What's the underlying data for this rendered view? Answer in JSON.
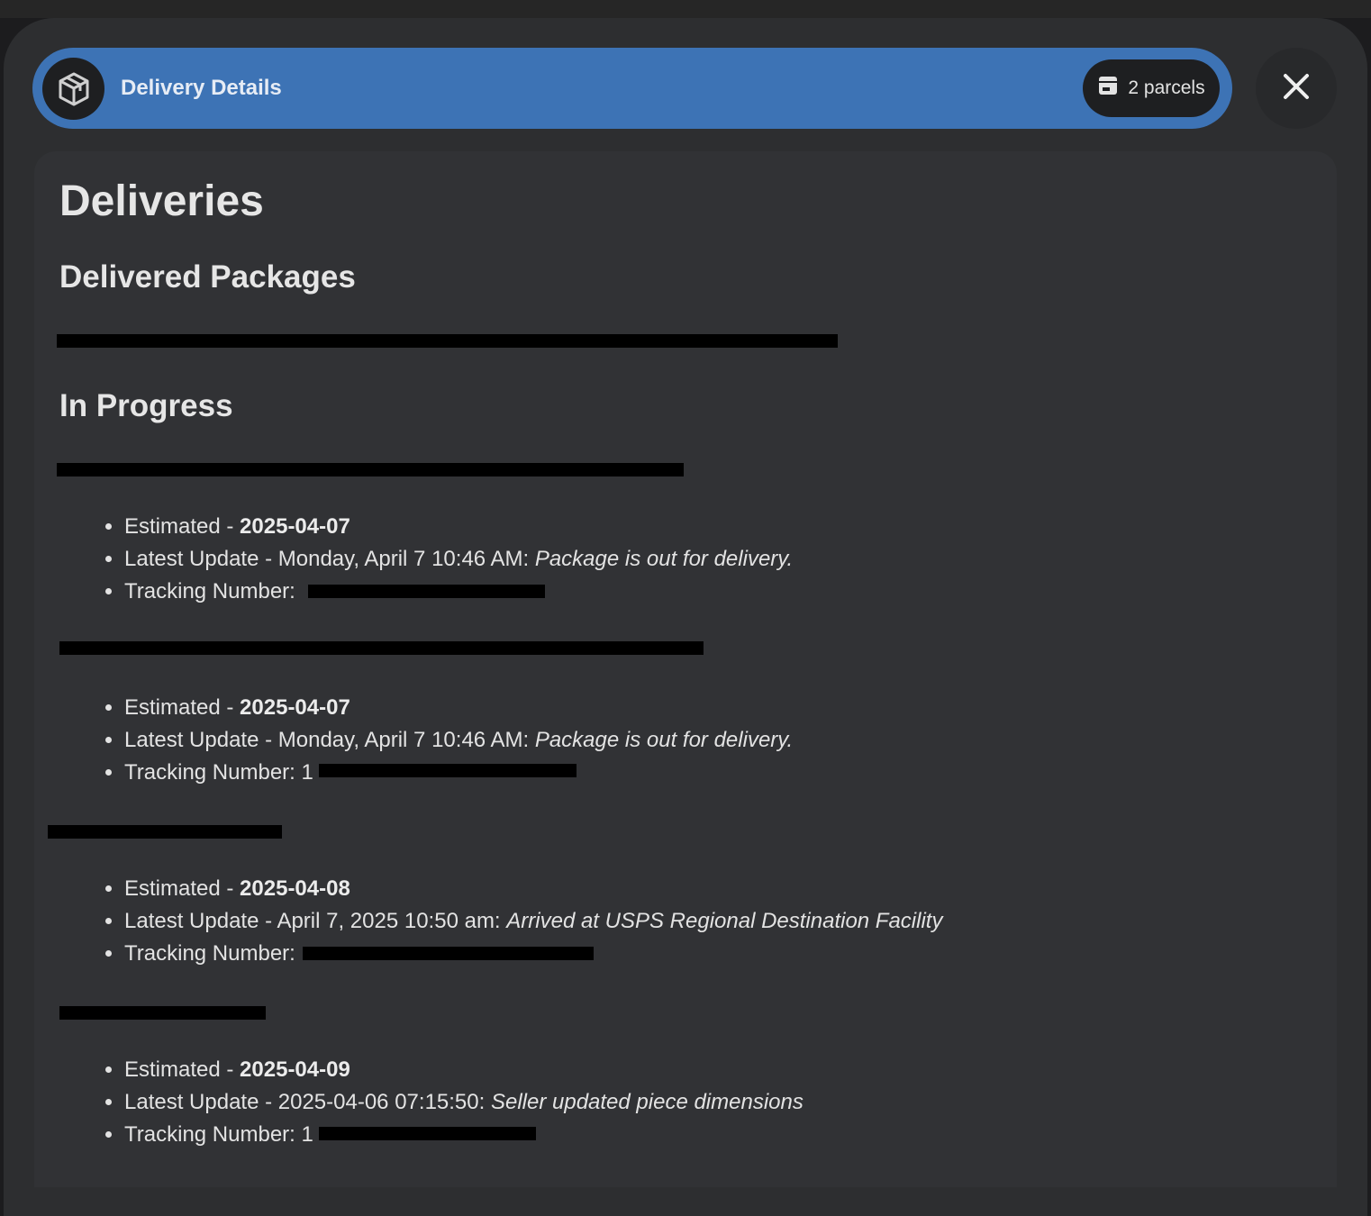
{
  "header": {
    "title": "Delivery Details",
    "parcels_label": "2 parcels",
    "icon": "package-icon",
    "close_icon": "close-icon"
  },
  "main": {
    "heading": "Deliveries",
    "delivered_heading": "Delivered Packages",
    "delivered_line": "",
    "in_progress_heading": "In Progress",
    "packages": [
      {
        "title": "",
        "estimated_label": "Estimated - ",
        "estimated": "2025-04-07",
        "update_label": "Latest Update - Monday, April 7 10:46 AM: ",
        "update_status": "Package is out for delivery.",
        "tracking_label": "Tracking Number: "
      },
      {
        "title": "",
        "estimated_label": "Estimated - ",
        "estimated": "2025-04-07",
        "update_label": "Latest Update - Monday, April 7 10:46 AM: ",
        "update_status": "Package is out for delivery.",
        "tracking_label": "Tracking Number: 1"
      },
      {
        "title": "",
        "estimated_label": "Estimated - ",
        "estimated": "2025-04-08",
        "update_label": "Latest Update - April 7, 2025 10:50 am: ",
        "update_status": "Arrived at USPS Regional Destination Facility",
        "tracking_label": "Tracking Number:"
      },
      {
        "title": "",
        "estimated_label": "Estimated - ",
        "estimated": "2025-04-09",
        "update_label": "Latest Update - 2025-04-06 07:15:50: ",
        "update_status": "Seller updated piece dimensions",
        "tracking_label": "Tracking Number: 1"
      }
    ]
  },
  "colors": {
    "header_bg": "#3d73b5",
    "dialog_bg": "#2d2e30",
    "card_bg": "#313235"
  }
}
